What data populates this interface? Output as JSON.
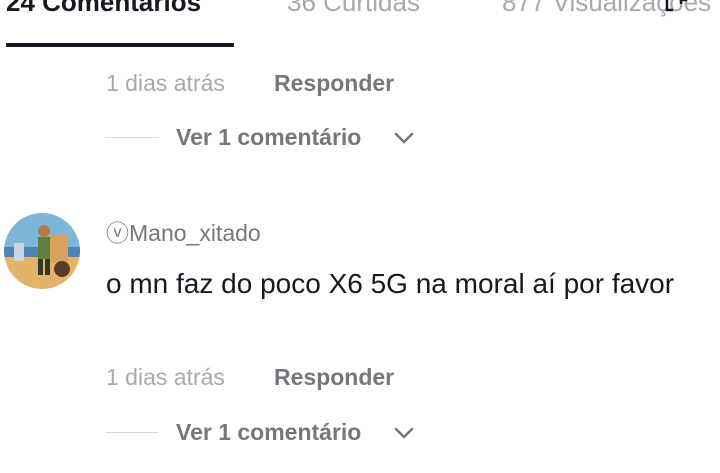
{
  "tabs": {
    "comments": "24 Comentários",
    "likes": "36 Curtidas",
    "views": "877 Visualizações"
  },
  "icons": {
    "expand": "expand-icon",
    "chevron": "chevron-down-icon",
    "avatar": "avatar-image"
  },
  "comment_prev": {
    "time": "1 dias atrás",
    "reply_label": "Responder",
    "view_replies_label": "Ver 1 comentário"
  },
  "comment": {
    "username": "ⓥMano_xitado",
    "text": "o mn faz do poco X6 5G na moral aí por favor",
    "time": "1 dias atrás",
    "reply_label": "Responder",
    "view_replies_label": "Ver 1 comentário"
  },
  "colors": {
    "text_primary": "#161823",
    "text_secondary": "#76777c",
    "text_muted": "#a8a9ad",
    "divider": "#d8d9dc"
  }
}
